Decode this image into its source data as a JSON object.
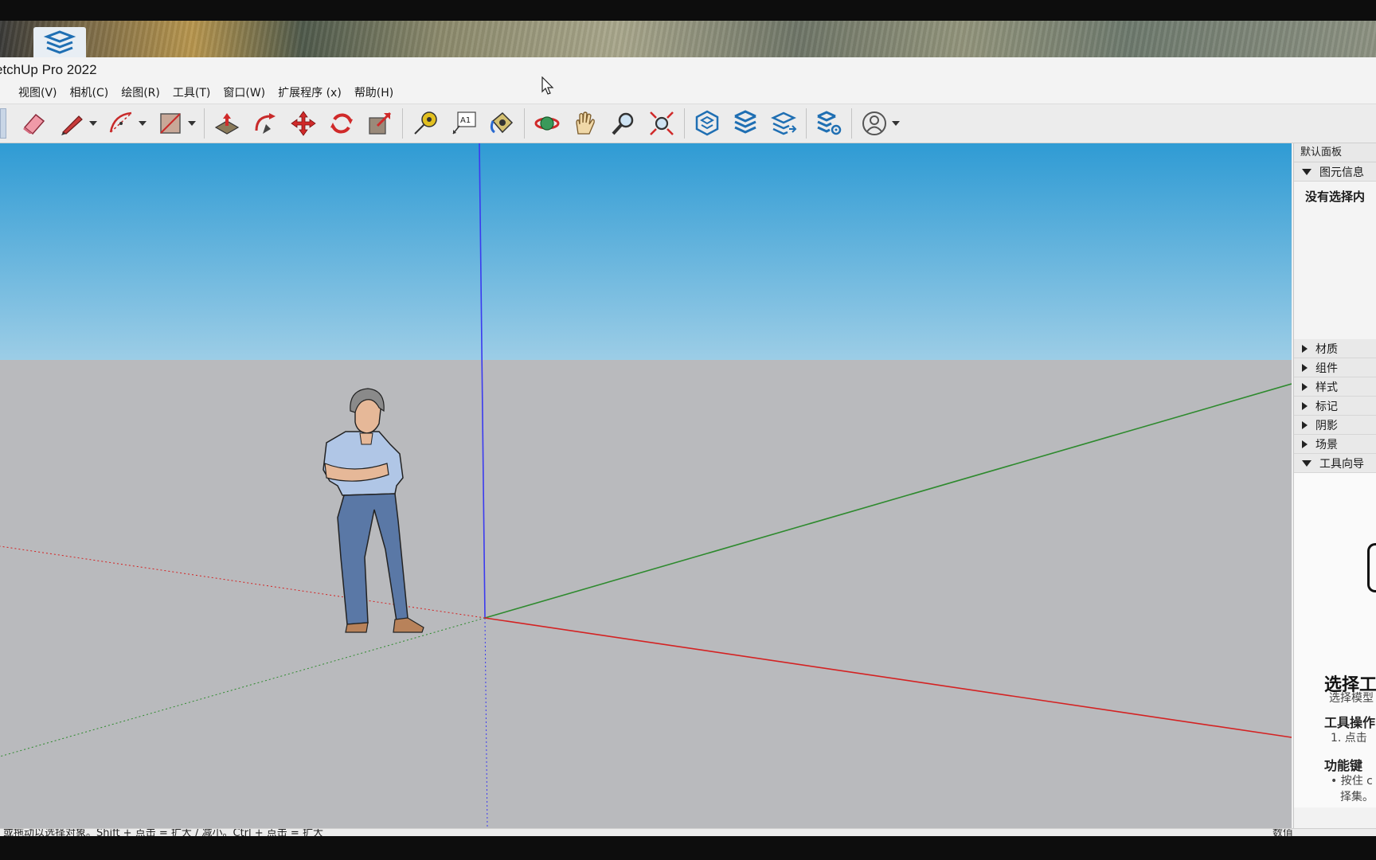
{
  "window": {
    "title": "etchUp Pro 2022"
  },
  "menu": [
    {
      "label": "视图(V)"
    },
    {
      "label": "相机(C)"
    },
    {
      "label": "绘图(R)"
    },
    {
      "label": "工具(T)"
    },
    {
      "label": "窗口(W)"
    },
    {
      "label": "扩展程序 (x)"
    },
    {
      "label": "帮助(H)"
    }
  ],
  "toolbar": {
    "tools": [
      {
        "icon": "eraser-icon"
      },
      {
        "icon": "pencil-line-icon"
      },
      {
        "icon": "arc-icon"
      },
      {
        "icon": "rectangle-icon"
      },
      {
        "icon": "push-pull-icon"
      },
      {
        "icon": "follow-me-icon"
      },
      {
        "icon": "move-icon"
      },
      {
        "icon": "rotate-icon"
      },
      {
        "icon": "scale-icon"
      },
      {
        "icon": "tape-measure-icon"
      },
      {
        "icon": "text-label-icon"
      },
      {
        "icon": "paint-bucket-icon"
      },
      {
        "icon": "orbit-icon"
      },
      {
        "icon": "pan-hand-icon"
      },
      {
        "icon": "zoom-icon"
      },
      {
        "icon": "zoom-extents-icon"
      },
      {
        "icon": "warehouse-icon"
      },
      {
        "icon": "extension-warehouse-icon"
      },
      {
        "icon": "layers-share-icon"
      },
      {
        "icon": "extension-manager-icon"
      },
      {
        "icon": "user-account-icon"
      }
    ],
    "text_tool_glyph": "A1"
  },
  "tray": {
    "title": "默认面板",
    "entity_info": {
      "label": "图元信息",
      "empty_text": "没有选择内"
    },
    "sections": [
      {
        "label": "材质"
      },
      {
        "label": "组件"
      },
      {
        "label": "样式"
      },
      {
        "label": "标记"
      },
      {
        "label": "阴影"
      },
      {
        "label": "场景"
      }
    ],
    "instructor": {
      "label": "工具向导",
      "title": "选择工",
      "subtitle": "选择模型",
      "ops_heading": "工具操作",
      "ops_step": "1. 点击",
      "keys_heading": "功能键",
      "keys_item_1": "• 按住 c",
      "keys_item_2": "择集。"
    }
  },
  "statusbar": {
    "left_text": "或拖动以选择对象。Shift + 点击 = 扩大 / 减小。Ctrl + 点击 = 扩大",
    "right_text": "数值"
  },
  "colors": {
    "sky_top": "#2f9bd4",
    "sky_bottom": "#9ccde6",
    "ground": "#b9babd",
    "blue_axis": "#3a3af0",
    "green_axis": "#2e8a2e",
    "red_axis": "#d42222"
  }
}
